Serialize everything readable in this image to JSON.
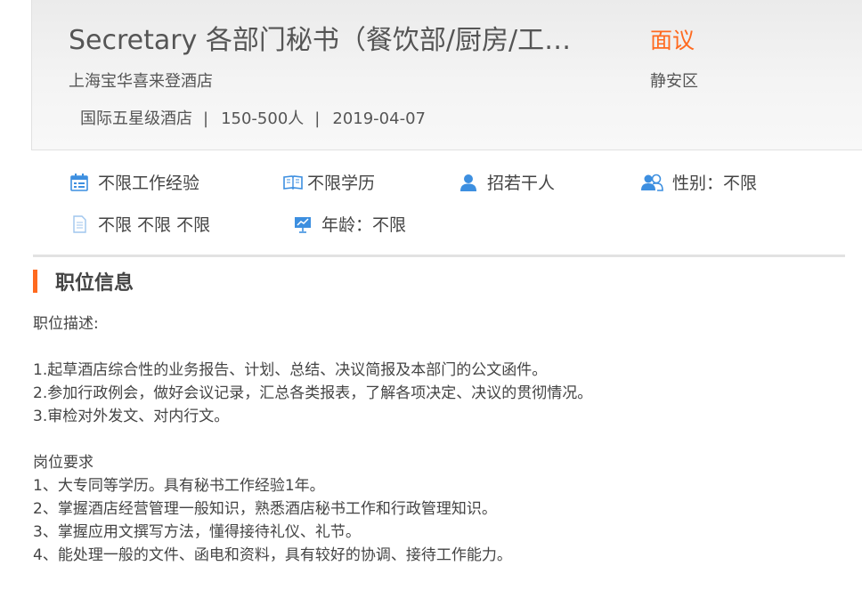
{
  "job": {
    "title": "Secretary 各部门秘书（餐饮部/厨房/工…",
    "salary": "面议",
    "company": "上海宝华喜来登酒店",
    "district": "静安区",
    "meta": [
      "国际五星级酒店",
      "150-500人",
      "2019-04-07"
    ],
    "meta_separator": "|"
  },
  "requirements": [
    {
      "icon": "calendar-icon",
      "text": "不限工作经验"
    },
    {
      "icon": "book-icon",
      "text": "不限学历"
    },
    {
      "icon": "person-icon",
      "text": "招若干人"
    },
    {
      "icon": "people-icon",
      "text": "性别：不限"
    },
    {
      "icon": "document-icon",
      "text": "不限 不限 不限"
    },
    {
      "icon": "presentation-icon",
      "text": "年龄：不限"
    }
  ],
  "section": {
    "title": "职位信息",
    "lines": [
      "职位描述:",
      "",
      "1.起草酒店综合性的业务报告、计划、总结、决议简报及本部门的公文函件。",
      "2.参加行政例会，做好会议记录，汇总各类报表，了解各项决定、决议的贯彻情况。",
      "3.审检对外发文、对内行文。",
      "",
      "岗位要求",
      "1、大专同等学历。具有秘书工作经验1年。",
      "2、掌握酒店经营管理一般知识，熟悉酒店秘书工作和行政管理知识。",
      "3、掌握应用文撰写方法，懂得接待礼仪、礼节。",
      "4、能处理一般的文件、函电和资料，具有较好的协调、接待工作能力。"
    ]
  },
  "colors": {
    "accent": "#ff6a1f",
    "icon_blue": "#3d8fe0"
  }
}
